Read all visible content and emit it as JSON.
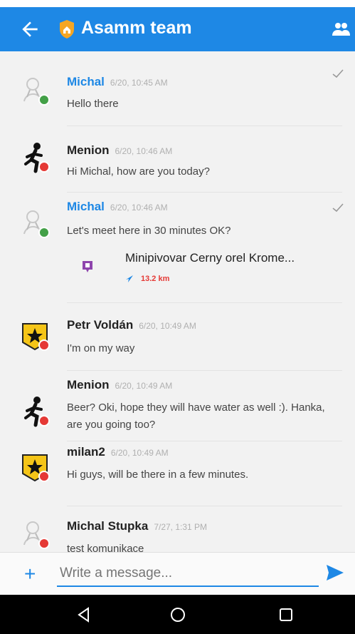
{
  "header": {
    "title": "Asamm team"
  },
  "messages": [
    {
      "name": "Michal",
      "time": "6/20, 10:45 AM",
      "text": "Hello there",
      "self": true
    },
    {
      "name": "Menion",
      "time": "6/20, 10:46 AM",
      "text": "Hi Michal, how are you today?",
      "self": false
    },
    {
      "name": "Michal",
      "time": "6/20, 10:46 AM",
      "text": "Let's meet here in 30 minutes OK?",
      "self": true,
      "place": {
        "name": "Minipivovar Cerny orel Krome...",
        "distance": "13.2 km"
      }
    },
    {
      "name": "Petr Voldán",
      "time": "6/20, 10:49 AM",
      "text": "I'm on my way",
      "self": false
    },
    {
      "name": "Menion",
      "time": "6/20, 10:49 AM",
      "text": "Beer? Oki, hope they will have water as well :). Hanka, are you going too?",
      "self": false
    },
    {
      "name": "milan2",
      "time": "6/20, 10:49 AM",
      "text": "Hi guys, will be there in a few minutes.",
      "self": false
    },
    {
      "name": "Michal Stupka",
      "time": "7/27, 1:31 PM",
      "text": "test komunikace",
      "self": false
    }
  ],
  "composer": {
    "placeholder": "Write a message..."
  },
  "colors": {
    "accent": "#1e88e5",
    "online": "#43a047",
    "offline": "#e53935"
  },
  "icons": [
    "back-arrow-icon",
    "group-logo-icon",
    "people-icon",
    "read-check-icon",
    "place-pin-icon",
    "direction-arrow-icon",
    "plus-icon",
    "send-icon",
    "nav-back-icon",
    "nav-home-icon",
    "nav-recents-icon"
  ]
}
